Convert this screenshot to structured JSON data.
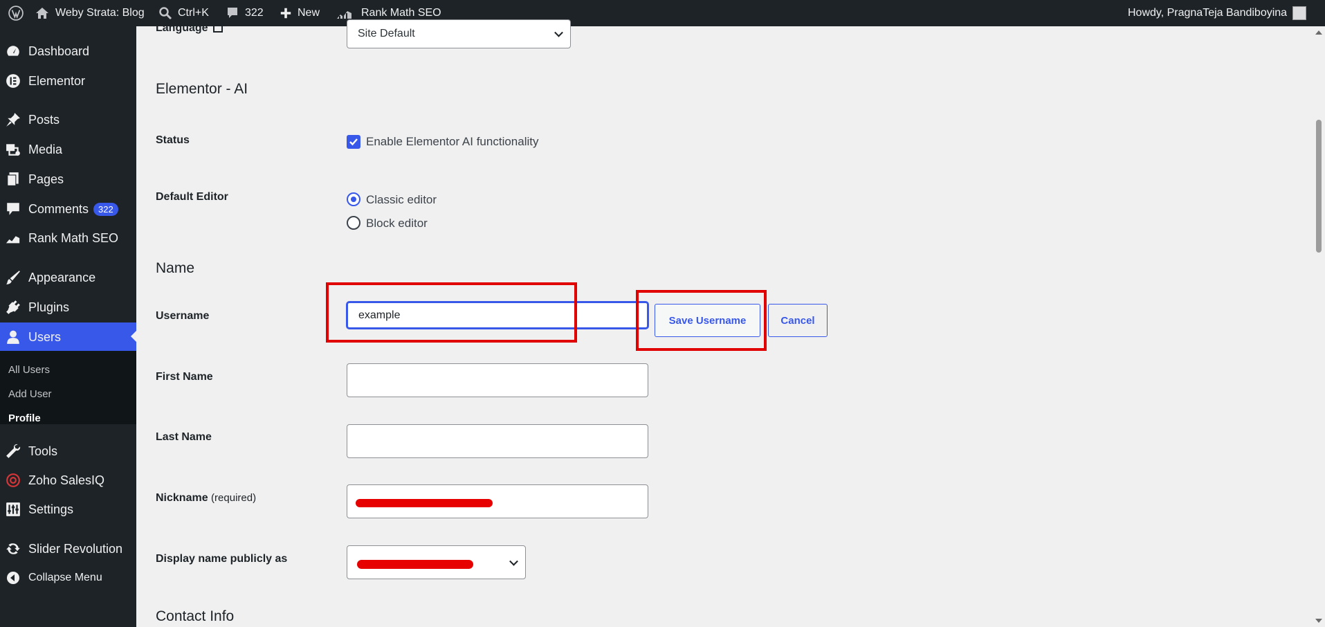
{
  "adminbar": {
    "site_name": "Weby Strata: Blog",
    "search_shortcut": "Ctrl+K",
    "comments_count": "322",
    "new_label": "New",
    "seo_label": "Rank Math SEO",
    "howdy": "Howdy, PragnaTeja Bandiboyina"
  },
  "sidebar": {
    "items": [
      {
        "label": "Dashboard",
        "icon": "dashboard-icon"
      },
      {
        "label": "Elementor",
        "icon": "elementor-icon"
      },
      {
        "label": "Posts",
        "icon": "pin-icon"
      },
      {
        "label": "Media",
        "icon": "media-icon"
      },
      {
        "label": "Pages",
        "icon": "pages-icon"
      },
      {
        "label": "Comments",
        "icon": "comments-icon",
        "badge": "322"
      },
      {
        "label": "Rank Math SEO",
        "icon": "rank-math-icon"
      },
      {
        "label": "Appearance",
        "icon": "brush-icon"
      },
      {
        "label": "Plugins",
        "icon": "plug-icon"
      },
      {
        "label": "Users",
        "icon": "user-icon"
      },
      {
        "label": "Tools",
        "icon": "wrench-icon"
      },
      {
        "label": "Zoho SalesIQ",
        "icon": "zoho-icon"
      },
      {
        "label": "Settings",
        "icon": "settings-icon"
      },
      {
        "label": "Slider Revolution",
        "icon": "refresh-icon"
      },
      {
        "label": "Collapse Menu",
        "icon": "collapse-icon"
      }
    ],
    "submenu": [
      "All Users",
      "Add User",
      "Profile"
    ]
  },
  "form": {
    "language_label": "Language",
    "language_value": "Site Default",
    "elementor_heading": "Elementor - AI",
    "status_label": "Status",
    "status_checkbox": "Enable Elementor AI functionality",
    "status_checked": true,
    "editor_label": "Default Editor",
    "editor_options": [
      "Classic editor",
      "Block editor"
    ],
    "editor_selected": "Classic editor",
    "name_heading": "Name",
    "username_label": "Username",
    "username_value": "example",
    "save_username": "Save Username",
    "cancel": "Cancel",
    "first_name_label": "First Name",
    "first_name_value": "",
    "last_name_label": "Last Name",
    "last_name_value": "",
    "nickname_label": "Nickname",
    "nickname_required": "(required)",
    "display_name_label": "Display name publicly as",
    "contact_heading": "Contact Info"
  },
  "colors": {
    "accent": "#3858e9",
    "annotation": "#e10000",
    "adminbar": "#1d2327"
  }
}
